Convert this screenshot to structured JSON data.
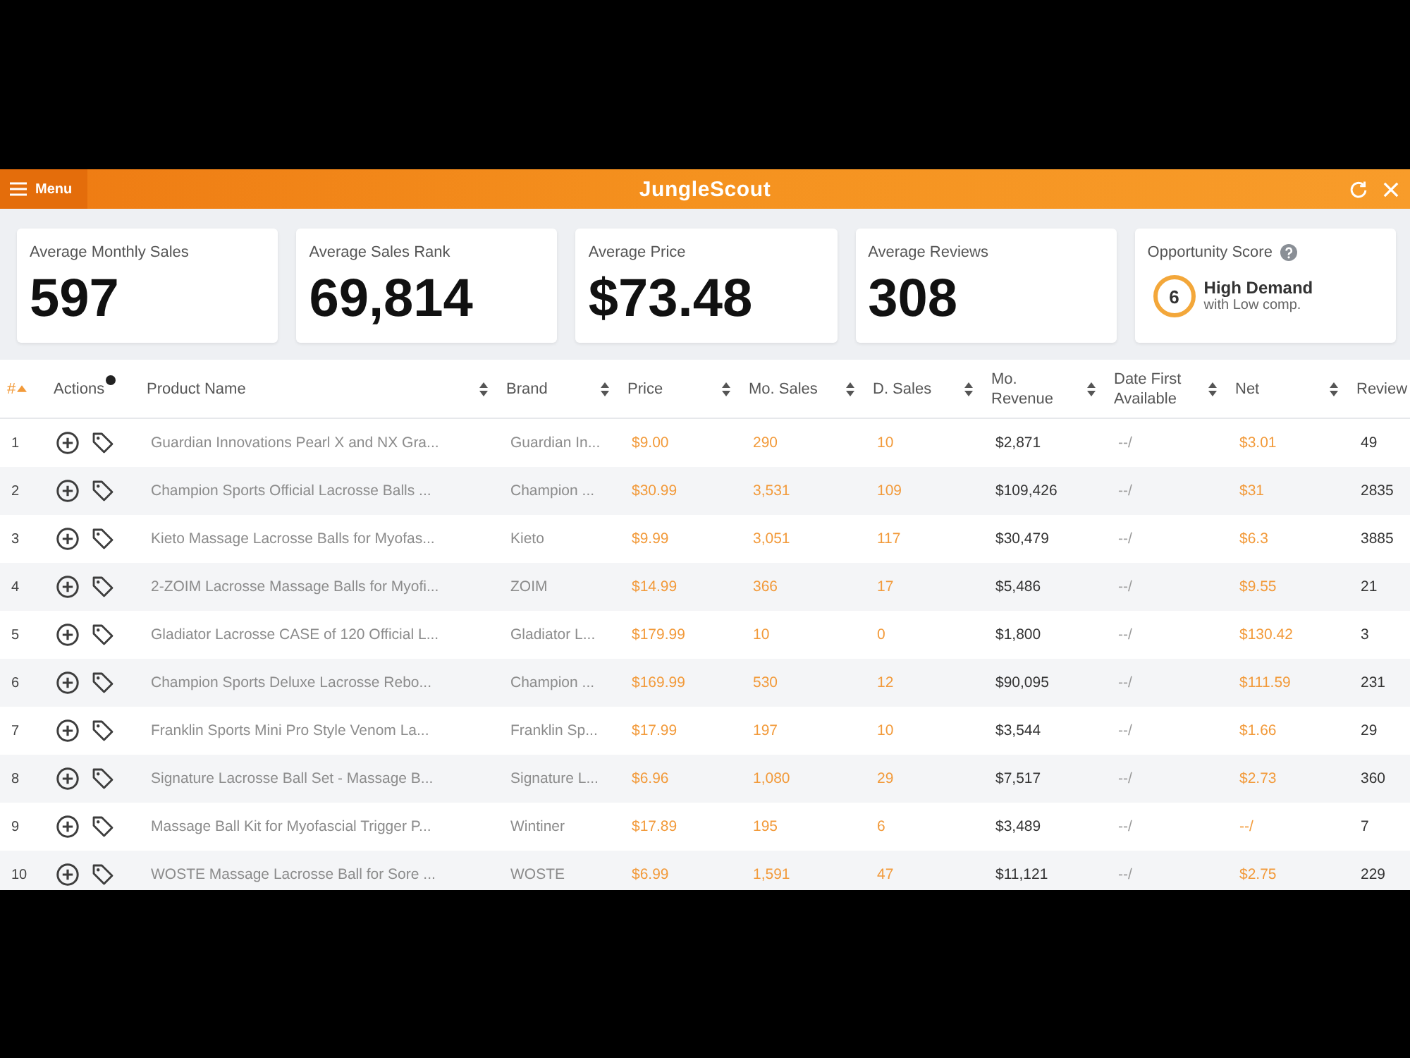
{
  "window": {
    "menu_label": "Menu",
    "title": "JungleScout"
  },
  "stats": [
    {
      "kind": "metric",
      "label": "Average Monthly Sales",
      "value": "597"
    },
    {
      "kind": "metric",
      "label": "Average Sales Rank",
      "value": "69,814"
    },
    {
      "kind": "metric",
      "label": "Average Price",
      "value": "$73.48"
    },
    {
      "kind": "metric",
      "label": "Average Reviews",
      "value": "308"
    },
    {
      "kind": "score",
      "label": "Opportunity Score",
      "score": "6",
      "headline": "High Demand",
      "subline": "with Low comp."
    }
  ],
  "table": {
    "columns": [
      {
        "label": "#",
        "kind": "sortable",
        "sorted": true
      },
      {
        "label": "Actions",
        "kind": "info",
        "sorted": false
      },
      {
        "label": "Product Name",
        "kind": "sortable",
        "sorted": false
      },
      {
        "label": "Brand",
        "kind": "sortable",
        "sorted": false
      },
      {
        "label": "Price",
        "kind": "sortable",
        "sorted": false
      },
      {
        "label": "Mo. Sales",
        "kind": "sortable",
        "sorted": false
      },
      {
        "label": "D. Sales",
        "kind": "sortable",
        "sorted": false
      },
      {
        "label": "Mo. Revenue",
        "kind": "sortable",
        "sorted": false
      },
      {
        "label": "Date First Available",
        "kind": "sortable",
        "sorted": false
      },
      {
        "label": "Net",
        "kind": "sortable",
        "sorted": false
      },
      {
        "label": "Review",
        "kind": "plain",
        "sorted": false
      }
    ],
    "rows": [
      {
        "index": "1",
        "product": "Guardian Innovations Pearl X and NX Gra...",
        "brand": "Guardian In...",
        "price": "$9.00",
        "mo_sales": "290",
        "d_sales": "10",
        "revenue": "$2,871",
        "date": "--/",
        "net": "$3.01",
        "reviews": "49"
      },
      {
        "index": "2",
        "product": "Champion Sports Official Lacrosse Balls ...",
        "brand": "Champion ...",
        "price": "$30.99",
        "mo_sales": "3,531",
        "d_sales": "109",
        "revenue": "$109,426",
        "date": "--/",
        "net": "$31",
        "reviews": "2835"
      },
      {
        "index": "3",
        "product": "Kieto Massage Lacrosse Balls for Myofas...",
        "brand": "Kieto",
        "price": "$9.99",
        "mo_sales": "3,051",
        "d_sales": "117",
        "revenue": "$30,479",
        "date": "--/",
        "net": "$6.3",
        "reviews": "3885"
      },
      {
        "index": "4",
        "product": "2-ZOIM Lacrosse Massage Balls for Myofi...",
        "brand": "ZOIM",
        "price": "$14.99",
        "mo_sales": "366",
        "d_sales": "17",
        "revenue": "$5,486",
        "date": "--/",
        "net": "$9.55",
        "reviews": "21"
      },
      {
        "index": "5",
        "product": "Gladiator Lacrosse CASE of 120 Official L...",
        "brand": "Gladiator L...",
        "price": "$179.99",
        "mo_sales": "10",
        "d_sales": "0",
        "revenue": "$1,800",
        "date": "--/",
        "net": "$130.42",
        "reviews": "3"
      },
      {
        "index": "6",
        "product": "Champion Sports Deluxe Lacrosse Rebo...",
        "brand": "Champion ...",
        "price": "$169.99",
        "mo_sales": "530",
        "d_sales": "12",
        "revenue": "$90,095",
        "date": "--/",
        "net": "$111.59",
        "reviews": "231"
      },
      {
        "index": "7",
        "product": "Franklin Sports Mini Pro Style Venom La...",
        "brand": "Franklin Sp...",
        "price": "$17.99",
        "mo_sales": "197",
        "d_sales": "10",
        "revenue": "$3,544",
        "date": "--/",
        "net": "$1.66",
        "reviews": "29"
      },
      {
        "index": "8",
        "product": "Signature Lacrosse Ball Set - Massage B...",
        "brand": "Signature L...",
        "price": "$6.96",
        "mo_sales": "1,080",
        "d_sales": "29",
        "revenue": "$7,517",
        "date": "--/",
        "net": "$2.73",
        "reviews": "360"
      },
      {
        "index": "9",
        "product": "Massage Ball Kit for Myofascial Trigger P...",
        "brand": "Wintiner",
        "price": "$17.89",
        "mo_sales": "195",
        "d_sales": "6",
        "revenue": "$3,489",
        "date": "--/",
        "net": "--/",
        "reviews": "7"
      },
      {
        "index": "10",
        "product": "WOSTE Massage Lacrosse Ball for Sore ...",
        "brand": "WOSTE",
        "price": "$6.99",
        "mo_sales": "1,591",
        "d_sales": "47",
        "revenue": "$11,121",
        "date": "--/",
        "net": "$2.75",
        "reviews": "229"
      }
    ]
  }
}
